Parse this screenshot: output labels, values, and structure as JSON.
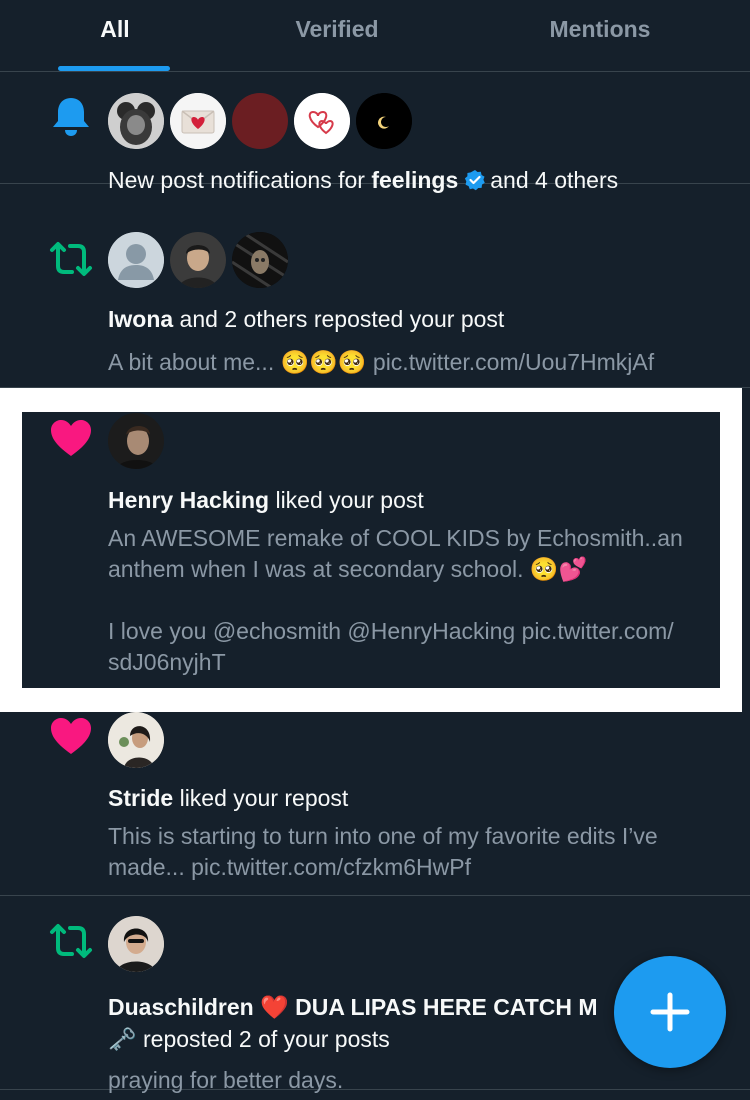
{
  "tabs": [
    {
      "label": "All",
      "active": true
    },
    {
      "label": "Verified",
      "active": false
    },
    {
      "label": "Mentions",
      "active": false
    }
  ],
  "notifications": [
    {
      "type": "new-post",
      "icon": "bell-icon",
      "text_prefix": "New post notifications for ",
      "bold_name": "feelings",
      "text_suffix": "and 4 others"
    },
    {
      "type": "repost",
      "icon": "repost-icon",
      "bold_name": "Iwona",
      "action": " and 2 others reposted your post",
      "body": "A bit about me... 🥺🥺🥺 pic.twitter.com/Uou7HmkjAf"
    },
    {
      "type": "like",
      "icon": "heart-icon",
      "bold_name": "Henry Hacking",
      "action": " liked your post",
      "body_line1": "An AWESOME remake of COOL KIDS by Echosmith..an",
      "body_line2": "anthem when I was at secondary school. 🥺💕",
      "body_line3": "I love you @echosmith @HenryHacking pic.twitter.com/",
      "body_line4": "sdJ06nyjhT"
    },
    {
      "type": "like",
      "icon": "heart-icon",
      "bold_name": "Stride",
      "action": " liked your repost",
      "body_line1": "This is starting to turn into one of my favorite edits I’ve",
      "body_line2": "made... pic.twitter.com/cfzkm6HwPf"
    },
    {
      "type": "repost",
      "icon": "repost-icon",
      "bold_name": "Duaschildren ❤️ DUA LIPAS HERE CATCH M",
      "action_line2": "🗝️ reposted 2 of your posts",
      "body": "praying for better days."
    }
  ],
  "colors": {
    "background": "#15202b",
    "accent": "#1d9bf0",
    "like": "#f91880",
    "repost": "#00ba7c",
    "muted_text": "#8b98a5",
    "divider": "#38444d"
  },
  "fab": {
    "icon": "plus-icon"
  }
}
